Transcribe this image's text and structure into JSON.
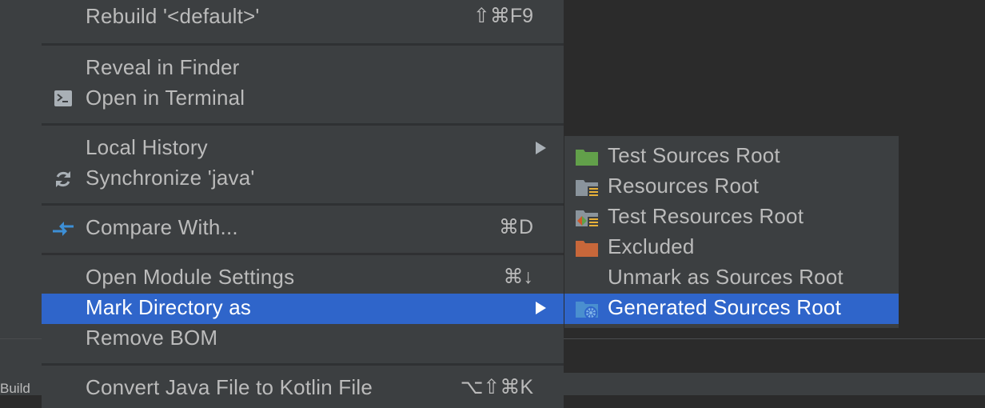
{
  "ide": {
    "bottom_tab_label": "Build"
  },
  "context_menu": {
    "items": [
      {
        "label": "Rebuild '<default>'",
        "shortcut": "⇧⌘F9"
      },
      {
        "label": "Reveal in Finder",
        "shortcut": ""
      },
      {
        "label": "Open in Terminal",
        "shortcut": "",
        "icon": "terminal-icon"
      },
      {
        "label": "Local History",
        "shortcut": "",
        "has_submenu": true
      },
      {
        "label": "Synchronize 'java'",
        "shortcut": "",
        "icon": "sync-icon"
      },
      {
        "label": "Compare With...",
        "shortcut": "⌘D",
        "icon": "compare-arrows-icon"
      },
      {
        "label": "Open Module Settings",
        "shortcut": "⌘↓"
      },
      {
        "label": "Mark Directory as",
        "shortcut": "",
        "has_submenu": true,
        "selected": true
      },
      {
        "label": "Remove BOM",
        "shortcut": ""
      },
      {
        "label": "Convert Java File to Kotlin File",
        "shortcut": "⌥⇧⌘K"
      }
    ]
  },
  "submenu": {
    "items": [
      {
        "label": "Test Sources Root",
        "icon": "test-sources-folder-icon"
      },
      {
        "label": "Resources Root",
        "icon": "resources-folder-icon"
      },
      {
        "label": "Test Resources Root",
        "icon": "test-resources-folder-icon"
      },
      {
        "label": "Excluded",
        "icon": "excluded-folder-icon"
      },
      {
        "label": "Unmark as Sources Root",
        "icon": ""
      },
      {
        "label": "Generated Sources Root",
        "icon": "generated-sources-folder-icon",
        "selected": true
      }
    ]
  },
  "colors": {
    "menu_bg": "#3c3f41",
    "selection": "#2f65ca",
    "text": "#bbbbbb",
    "test_folder": "#62a04a",
    "excluded_folder": "#c7673a",
    "resources_folder": "#8a949c",
    "resources_doc": "#e8b23a",
    "generated_folder": "#4a8fcf"
  }
}
